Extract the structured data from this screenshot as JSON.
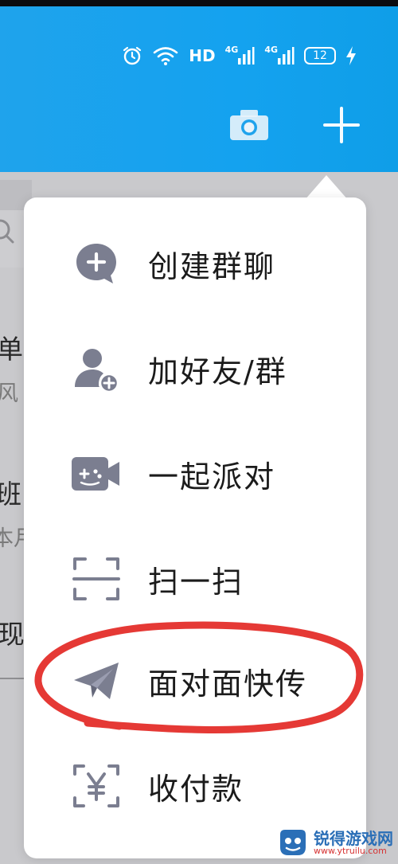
{
  "status_bar": {
    "network_label": "HD",
    "signal_1_label": "4G",
    "signal_2_label": "4G",
    "battery_level": "12"
  },
  "header": {
    "camera_icon": "camera-icon",
    "add_icon": "plus-icon"
  },
  "background_fragments": [
    {
      "text": "单",
      "style": "main"
    },
    {
      "text": "风",
      "style": "sub"
    },
    {
      "text": "班",
      "style": "main"
    },
    {
      "text": "本月",
      "style": "sub"
    },
    {
      "text": "J现",
      "style": "main"
    }
  ],
  "menu": {
    "items": [
      {
        "label": "创建群聊",
        "icon": "create-group-chat-icon"
      },
      {
        "label": "加好友/群",
        "icon": "add-friend-icon"
      },
      {
        "label": "一起派对",
        "icon": "party-gamepad-icon"
      },
      {
        "label": "扫一扫",
        "icon": "scan-icon"
      },
      {
        "label": "面对面快传",
        "icon": "paper-plane-icon"
      },
      {
        "label": "收付款",
        "icon": "payment-yuan-icon"
      }
    ]
  },
  "annotation": {
    "color": "#e53935",
    "target": "面对面快传"
  },
  "watermark": {
    "title": "锐得游戏网",
    "url": "www.ytruilu.com",
    "brand_color": "#2b6fb7"
  }
}
